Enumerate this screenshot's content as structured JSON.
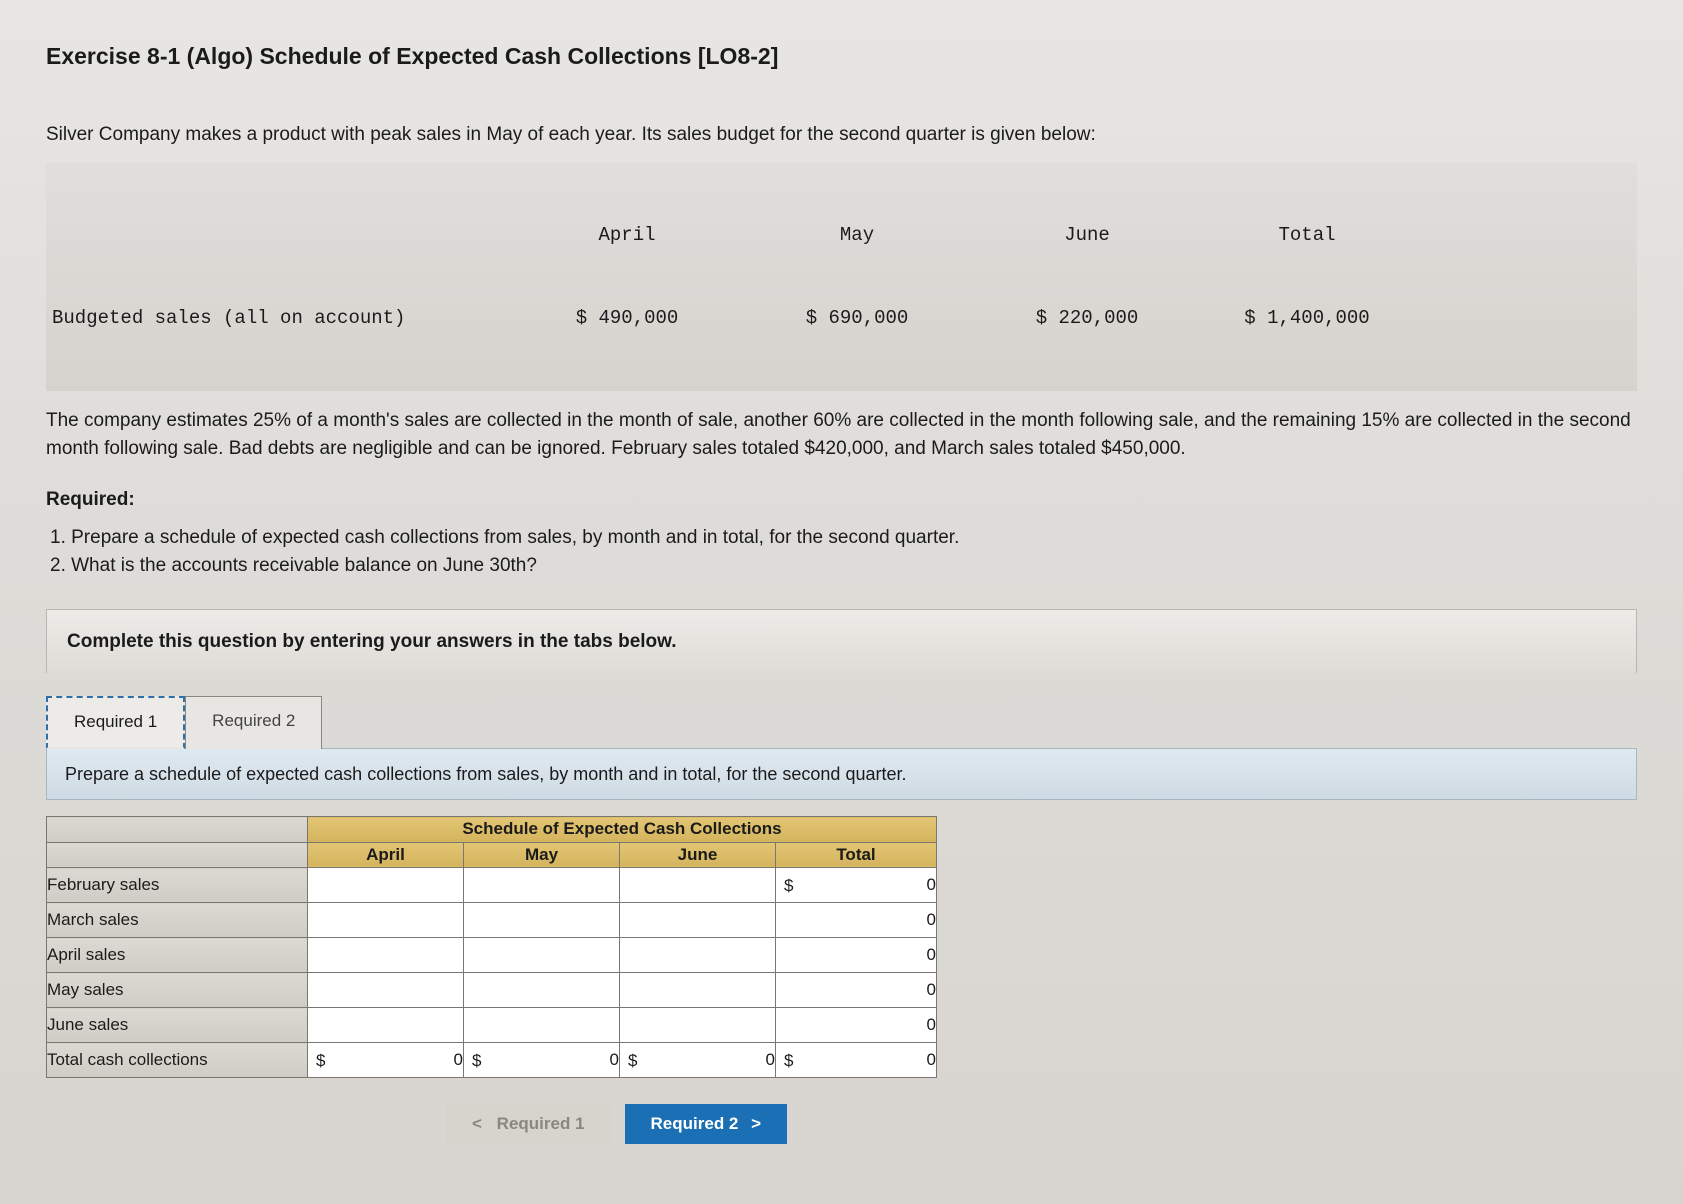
{
  "title": "Exercise 8-1 (Algo) Schedule of Expected Cash Collections [LO8-2]",
  "intro": "Silver Company makes a product with peak sales in May of each year. Its sales budget for the second quarter is given below:",
  "budget_table": {
    "row_label": "Budgeted sales (all on account)",
    "columns": [
      "April",
      "May",
      "June",
      "Total"
    ],
    "values": [
      "$ 490,000",
      "$ 690,000",
      "$ 220,000",
      "$ 1,400,000"
    ]
  },
  "collections_policy": "The company estimates 25% of a month's sales are collected in the month of sale, another 60% are collected in the month following sale, and the remaining 15% are collected in the second month following sale. Bad debts are negligible and can be ignored. February sales totaled $420,000, and March sales totaled $450,000.",
  "required_header": "Required:",
  "requirements": [
    "1.  Prepare a schedule of expected cash collections from sales, by month and in total, for the second quarter.",
    "2.  What is the accounts receivable balance on June 30th?"
  ],
  "instructions_bar": "Complete this question by entering your answers in the tabs below.",
  "tabs": {
    "tab1": "Required 1",
    "tab2": "Required 2"
  },
  "sub_instruction": "Prepare a schedule of expected cash collections from sales, by month and in total, for the second quarter.",
  "answer_table": {
    "main_header": "Schedule of Expected Cash Collections",
    "col_headers": [
      "April",
      "May",
      "June",
      "Total"
    ],
    "rows": [
      "February sales",
      "March sales",
      "April sales",
      "May sales",
      "June sales",
      "Total cash collections"
    ],
    "totals_initial": [
      "0",
      "0",
      "0",
      "0",
      "0"
    ],
    "bottom_row": {
      "april": {
        "prefix": "$",
        "value": "0"
      },
      "may": {
        "prefix": "$",
        "value": "0"
      },
      "june": {
        "prefix": "$",
        "value": "0"
      },
      "total": {
        "prefix": "$",
        "value": "0"
      }
    },
    "first_total_prefix": "$"
  },
  "nav": {
    "prev": "Required 1",
    "next": "Required 2"
  },
  "glyphs": {
    "left": "<",
    "right": ">"
  }
}
